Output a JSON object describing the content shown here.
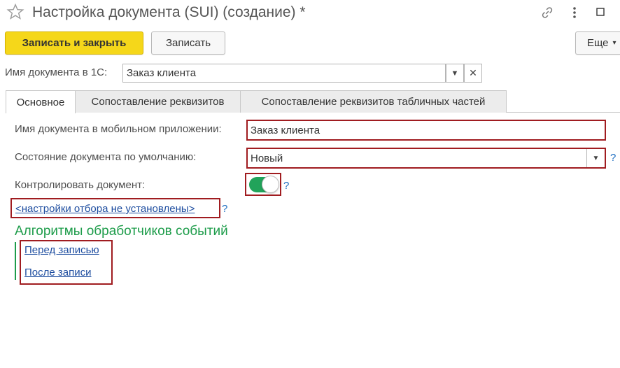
{
  "window": {
    "title": "Настройка документа (SUI) (создание) *",
    "icons": {
      "favorite": "star-icon",
      "link": "link-icon",
      "more": "more-vertical-icon",
      "maximize": "maximize-icon"
    }
  },
  "toolbar": {
    "save_close_label": "Записать и закрыть",
    "save_label": "Записать",
    "more_label": "Еще"
  },
  "doc_name": {
    "label": "Имя документа в 1С:",
    "value": "Заказ клиента"
  },
  "tabs": [
    {
      "label": "Основное",
      "active": true
    },
    {
      "label": "Сопоставление реквизитов",
      "active": false
    },
    {
      "label": "Сопоставление реквизитов табличных частей",
      "active": false
    }
  ],
  "form": {
    "mobile_name_label": "Имя документа в мобильном приложении:",
    "mobile_name_value": "Заказ клиента",
    "default_state_label": "Состояние документа по умолчанию:",
    "default_state_value": "Новый",
    "control_label": "Контролировать документ:",
    "control_on": true,
    "filter_link": "<настройки отбора не установлены>",
    "help": "?"
  },
  "handlers": {
    "title": "Алгоритмы обработчиков событий",
    "before_write": "Перед записью",
    "after_write": "После записи"
  },
  "colors": {
    "primary_button": "#f5d71a",
    "highlight_border": "#a01c20",
    "section_title": "#1d9c4a",
    "toggle_on": "#21a35a",
    "link": "#1f4ea0",
    "help": "#1f6fc2"
  }
}
